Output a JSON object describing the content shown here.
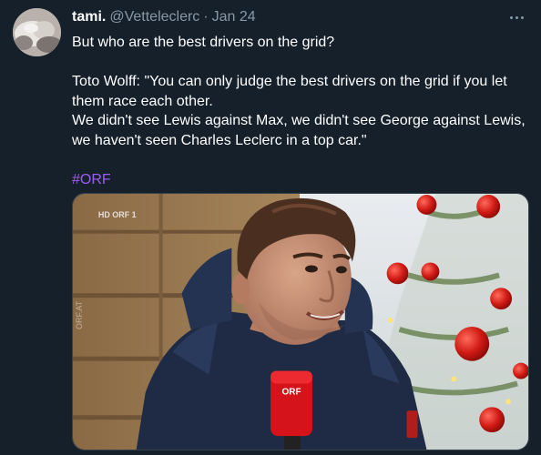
{
  "author": {
    "display_name": "tami.",
    "handle": "@Vetteleclerc",
    "separator": "·",
    "date": "Jan 24"
  },
  "tweet": {
    "line1": "But who are the best drivers on the grid?",
    "line2": "Toto Wolff: \"You can only judge the best drivers on the grid if you let them race each other.",
    "line3": "We didn't see Lewis against Max, we didn't see George against Lewis, we haven't seen Charles Leclerc in a top car.\"",
    "hashtag": "#ORF"
  },
  "media": {
    "broadcast_logo": "HD ORF 1",
    "side_watermark": "ORF.AT",
    "mic_label": "ORF"
  },
  "icons": {
    "more": "more-horizontal-icon"
  },
  "colors": {
    "background": "#15202b",
    "secondary_text": "#8899a6",
    "hashtag": "#9d5cf0"
  }
}
